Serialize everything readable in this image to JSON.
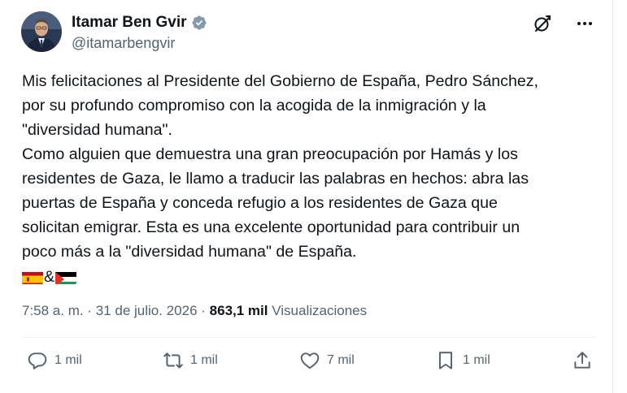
{
  "author": {
    "name": "Itamar Ben Gvir",
    "handle": "@itamarbengvir"
  },
  "tweet": {
    "lines": [
      "Mis felicitaciones al Presidente del Gobierno de España, Pedro Sánchez,",
      "por su profundo compromiso con la acogida de la inmigración y la",
      "\"diversidad humana\".",
      "Como alguien que demuestra una gran preocupación por Hamás y los",
      "residentes de Gaza, le llamo a traducir las palabras en hechos: abra las",
      "puertas de España y conceda refugio a los residentes de Gaza que",
      "solicitan emigrar. Esta es una excelente oportunidad para contribuir un",
      "poco más a la \"diversidad humana\" de España."
    ],
    "flag_separator": "&",
    "flags": [
      "spain-flag",
      "palestine-flag"
    ]
  },
  "meta": {
    "time": "7:58 a. m.",
    "date": "31 de julio. 2026",
    "separator": "·",
    "views_count": "863,1 mil",
    "views_label": "Visualizaciones"
  },
  "actions": {
    "reply_count": "1 mil",
    "retweet_count": "1 mil",
    "like_count": "7 mil",
    "bookmark_count": "1 mil"
  },
  "colors": {
    "text": "#0f1419",
    "secondary": "#536471",
    "verified": "#829aab",
    "border": "#e7e9ea"
  },
  "icons": {
    "verified": "verified-badge-icon",
    "grok": "grok-icon",
    "more": "more-icon",
    "reply": "reply-icon",
    "retweet": "retweet-icon",
    "like": "heart-icon",
    "bookmark": "bookmark-icon",
    "share": "share-icon"
  }
}
